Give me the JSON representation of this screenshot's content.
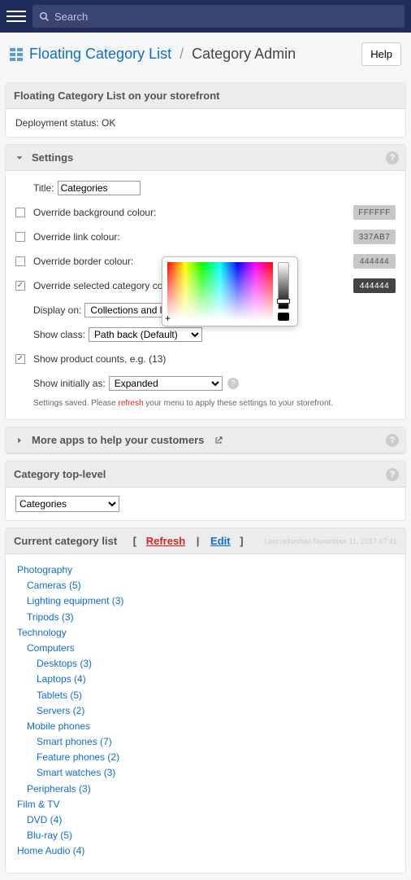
{
  "topbar": {
    "search_placeholder": "Search"
  },
  "breadcrumb": {
    "app_name": "Floating Category List",
    "current": "Category Admin",
    "help_label": "Help"
  },
  "storefront_panel": {
    "title": "Floating Category List on your storefront",
    "status_line": "Deployment status: OK"
  },
  "settings": {
    "header": "Settings",
    "title_label": "Title:",
    "title_value": "Categories",
    "rows": {
      "bg": {
        "label": "Override background colour:",
        "hex": "FFFFFF"
      },
      "link": {
        "label": "Override link colour:",
        "hex": "337AB7"
      },
      "border": {
        "label": "Override border colour:",
        "hex": "444444"
      },
      "selcat": {
        "label": "Override selected category colour:",
        "hex": "444444"
      }
    },
    "display_on_label": "Display on:",
    "display_on_value": "Collections and linked pages",
    "show_class_label": "Show class:",
    "show_class_value": "Path back (Default)",
    "show_counts_label": "Show product counts, e.g. (13)",
    "show_initially_label": "Show initially as:",
    "show_initially_value": "Expanded",
    "saved_prefix": "Settings saved. Please ",
    "saved_refresh": "refresh",
    "saved_suffix": " your menu to apply these settings to your storefront."
  },
  "more_apps": {
    "header": "More apps to help your customers"
  },
  "toplevel": {
    "header": "Category top-level",
    "value": "Categories"
  },
  "catlist": {
    "header_label": "Current category list",
    "refresh": "Refresh",
    "edit": "Edit",
    "last_refreshed": "Last refreshed November 11, 2017 07:41",
    "tree": [
      {
        "label": "Photography",
        "indent": 0
      },
      {
        "label": "Cameras (5)",
        "indent": 1
      },
      {
        "label": "Lighting equipment (3)",
        "indent": 1
      },
      {
        "label": "Tripods (3)",
        "indent": 1
      },
      {
        "label": "Technology",
        "indent": 0
      },
      {
        "label": "Computers",
        "indent": 1
      },
      {
        "label": "Desktops (3)",
        "indent": 2
      },
      {
        "label": "Laptops (4)",
        "indent": 2
      },
      {
        "label": "Tablets (5)",
        "indent": 2
      },
      {
        "label": "Servers (2)",
        "indent": 2
      },
      {
        "label": "Mobile phones",
        "indent": 1
      },
      {
        "label": "Smart phones (7)",
        "indent": 2
      },
      {
        "label": "Feature phones (2)",
        "indent": 2
      },
      {
        "label": "Smart watches (3)",
        "indent": 2
      },
      {
        "label": "Peripherals (3)",
        "indent": 1
      },
      {
        "label": "Film & TV",
        "indent": 0
      },
      {
        "label": "DVD (4)",
        "indent": 1
      },
      {
        "label": "Blu-ray (5)",
        "indent": 1
      },
      {
        "label": "Home Audio (4)",
        "indent": 0
      }
    ]
  }
}
